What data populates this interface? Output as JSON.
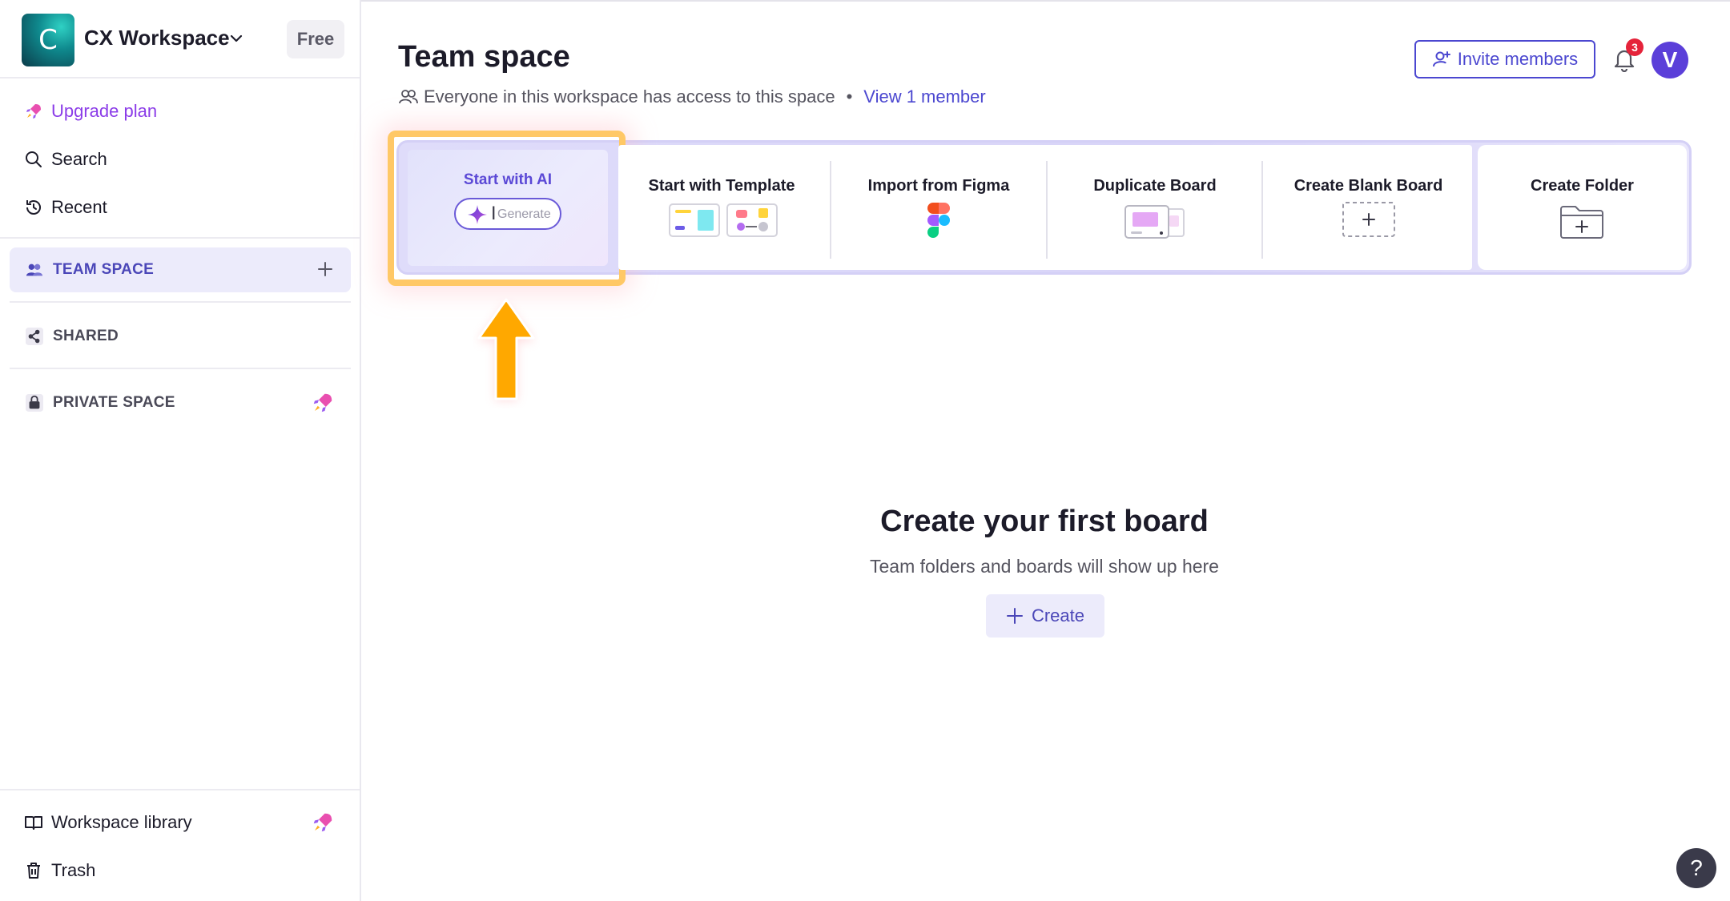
{
  "workspace": {
    "logo_letter": "C",
    "name": "CX Workspace",
    "plan_badge": "Free"
  },
  "sidebar": {
    "upgrade_label": "Upgrade plan",
    "search_label": "Search",
    "recent_label": "Recent",
    "spaces": [
      {
        "label": "TEAM SPACE"
      },
      {
        "label": "SHARED"
      },
      {
        "label": "PRIVATE SPACE"
      }
    ],
    "library_label": "Workspace library",
    "trash_label": "Trash"
  },
  "header": {
    "title": "Team space",
    "access_text": "Everyone in this workspace has access to this space",
    "separator": "•",
    "view_members_link": "View 1 member",
    "invite_label": "Invite members",
    "notification_count": "3",
    "avatar_letter": "V"
  },
  "actions": [
    {
      "label": "Start with AI",
      "input_placeholder": "Generate"
    },
    {
      "label": "Start with Template"
    },
    {
      "label": "Import from Figma"
    },
    {
      "label": "Duplicate Board"
    },
    {
      "label": "Create Blank Board"
    },
    {
      "label": "Create Folder"
    }
  ],
  "empty_state": {
    "title": "Create your first board",
    "subtitle": "Team folders and boards will show up here",
    "create_label": "Create"
  },
  "help": {
    "label": "?"
  },
  "colors": {
    "accent": "#4b47d0",
    "highlight": "#ffc866",
    "arrow": "#ffa800",
    "notification": "#e5233a",
    "upgrade": "#8b3ce8"
  }
}
